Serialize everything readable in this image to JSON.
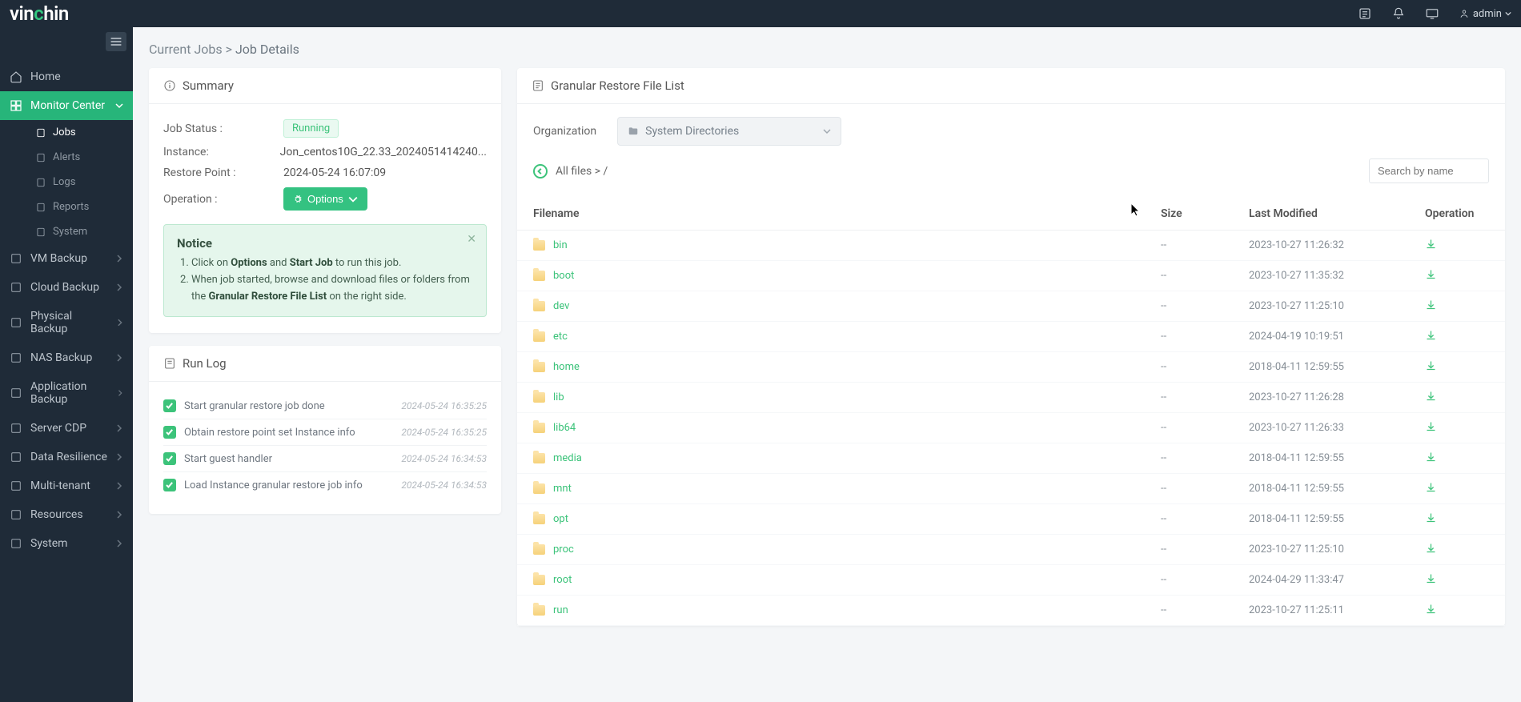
{
  "brand": "vinchin",
  "user_label": "admin",
  "breadcrumb": {
    "parent": "Current Jobs",
    "current": "Job Details"
  },
  "sidebar": {
    "home": "Home",
    "monitor": "Monitor Center",
    "monitor_sub": [
      "Jobs",
      "Alerts",
      "Logs",
      "Reports",
      "System"
    ],
    "items": [
      "VM Backup",
      "Cloud Backup",
      "Physical Backup",
      "NAS Backup",
      "Application Backup",
      "Server CDP",
      "Data Resilience",
      "Multi-tenant",
      "Resources",
      "System"
    ]
  },
  "summary": {
    "title": "Summary",
    "rows": {
      "job_status_label": "Job Status :",
      "job_status_value": "Running",
      "instance_label": "Instance:",
      "instance_value": "Jon_centos10G_22.33_2024051414240...",
      "restore_point_label": "Restore Point :",
      "restore_point_value": "2024-05-24 16:07:09",
      "operation_label": "Operation :",
      "options_btn": "Options"
    },
    "notice_title": "Notice",
    "notice_item1_pre": "Click on ",
    "notice_item1_b1": "Options",
    "notice_item1_mid": " and ",
    "notice_item1_b2": "Start Job",
    "notice_item1_post": " to run this job.",
    "notice_item2_pre": "When job started, browse and download files or folders from the ",
    "notice_item2_b": "Granular Restore File List",
    "notice_item2_post": " on the right side."
  },
  "runlog": {
    "title": "Run Log",
    "entries": [
      {
        "msg": "Start granular restore job done",
        "time": "2024-05-24 16:35:25"
      },
      {
        "msg": "Obtain restore point set Instance info",
        "time": "2024-05-24 16:35:25"
      },
      {
        "msg": "Start guest handler",
        "time": "2024-05-24 16:34:53"
      },
      {
        "msg": "Load Instance granular restore job info",
        "time": "2024-05-24 16:34:53"
      }
    ]
  },
  "filelist": {
    "title": "Granular Restore File List",
    "org_label": "Organization",
    "org_select": "System Directories",
    "path_label": "All files > /",
    "search_placeholder": "Search by name",
    "columns": {
      "filename": "Filename",
      "size": "Size",
      "modified": "Last Modified",
      "operation": "Operation"
    },
    "rows": [
      {
        "name": "bin",
        "size": "--",
        "mod": "2023-10-27 11:26:32"
      },
      {
        "name": "boot",
        "size": "--",
        "mod": "2023-10-27 11:35:32"
      },
      {
        "name": "dev",
        "size": "--",
        "mod": "2023-10-27 11:25:10"
      },
      {
        "name": "etc",
        "size": "--",
        "mod": "2024-04-19 10:19:51"
      },
      {
        "name": "home",
        "size": "--",
        "mod": "2018-04-11 12:59:55"
      },
      {
        "name": "lib",
        "size": "--",
        "mod": "2023-10-27 11:26:28"
      },
      {
        "name": "lib64",
        "size": "--",
        "mod": "2023-10-27 11:26:33"
      },
      {
        "name": "media",
        "size": "--",
        "mod": "2018-04-11 12:59:55"
      },
      {
        "name": "mnt",
        "size": "--",
        "mod": "2018-04-11 12:59:55"
      },
      {
        "name": "opt",
        "size": "--",
        "mod": "2018-04-11 12:59:55"
      },
      {
        "name": "proc",
        "size": "--",
        "mod": "2023-10-27 11:25:10"
      },
      {
        "name": "root",
        "size": "--",
        "mod": "2024-04-29 11:33:47"
      },
      {
        "name": "run",
        "size": "--",
        "mod": "2023-10-27 11:25:11"
      }
    ]
  },
  "colors": {
    "accent": "#34c281",
    "header": "#1f2b38"
  }
}
